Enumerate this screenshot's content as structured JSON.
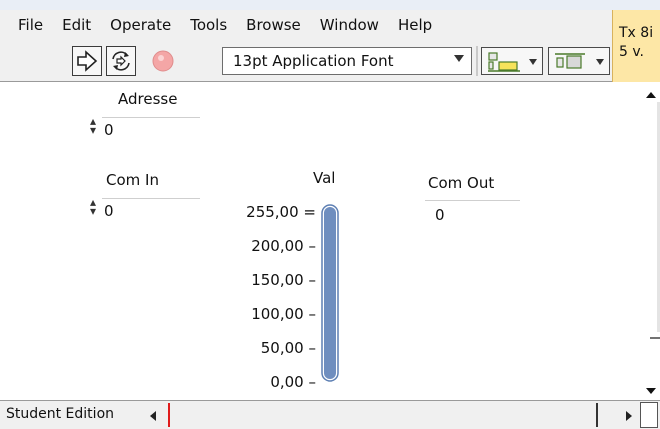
{
  "menu": [
    "File",
    "Edit",
    "Operate",
    "Tools",
    "Browse",
    "Window",
    "Help"
  ],
  "toolbar": {
    "font_selector": "13pt Application Font",
    "icons": [
      "run-arrow-icon",
      "run-continuously-icon",
      "abort-stop-icon",
      "align-objects-icon",
      "distribute-objects-icon"
    ]
  },
  "help_box": {
    "line1": "Tx 8i",
    "line2": "5 v."
  },
  "controls": {
    "adresse": {
      "label": "Adresse",
      "value": "0"
    },
    "com_in": {
      "label": "Com In",
      "value": "0"
    },
    "com_out": {
      "label": "Com Out",
      "value": "0"
    }
  },
  "tank": {
    "label": "Val",
    "scale": [
      "255,00",
      "200,00",
      "150,00",
      "100,00",
      "50,00",
      "0,00"
    ],
    "fill_percent": 100
  },
  "status": {
    "edition": "Student Edition"
  }
}
